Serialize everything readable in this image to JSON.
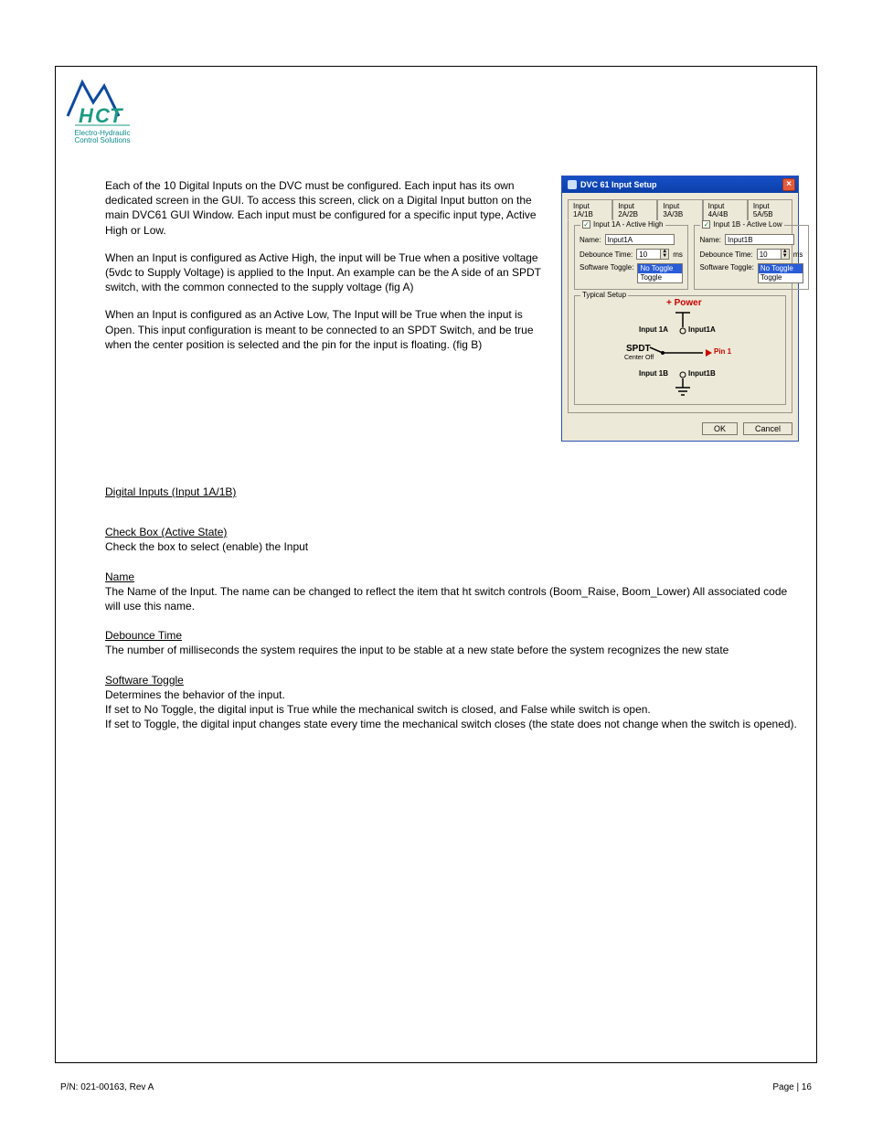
{
  "logo": {
    "brand": "HCT",
    "tag1": "Electro-Hydraulic",
    "tag2": "Control Solutions"
  },
  "intro": {
    "p1": "Each of the 10 Digital Inputs on the DVC must be configured. Each input has its own dedicated screen in the GUI. To access this screen, click on a Digital Input button on the main DVC61 GUI Window. Each input must be configured for a specific input type, Active High or Low.",
    "p2": "When an Input is configured as Active High, the input will be True when a positive voltage (5vdc to Supply Voltage) is applied to the Input. An example can be the A side of an SPDT switch, with the common connected to the supply voltage (fig A)",
    "p3": "When an Input is configured as an Active Low, The Input will be True when the input is Open. This input configuration is meant to be connected to an SPDT Switch, and be true when the center position is selected and the pin for the input is floating. (fig B)"
  },
  "sections": {
    "digital_inputs_heading": "Digital Inputs (Input 1A/1B)",
    "checkbox_heading": "Check Box (Active State)",
    "checkbox_text": "Check the box to select (enable) the Input",
    "name_heading": "Name",
    "name_text": "The Name of the Input. The name can be changed to reflect the item that ht switch controls (Boom_Raise, Boom_Lower) All associated code will use this name.",
    "debounce_heading": "Debounce Time",
    "debounce_text": "The number of milliseconds the system requires the input to be stable at a new state before the system recognizes the new state",
    "toggle_heading": "Software Toggle",
    "toggle_text": "Determines the behavior of the input.",
    "toggle_rule1": "If set to No Toggle, the digital input is True while the mechanical switch is closed, and False while switch is open.",
    "toggle_rule2": "If set to Toggle, the digital input changes state every time the mechanical switch closes (the state does not change when the switch is opened)."
  },
  "dialog": {
    "title": "DVC 61 Input Setup",
    "tabs": [
      "Input 1A/1B",
      "Input 2A/2B",
      "Input 3A/3B",
      "Input 4A/4B",
      "Input 5A/5B"
    ],
    "left": {
      "legend": "Input 1A - Active High",
      "checked": true,
      "name_label": "Name:",
      "name_value": "Input1A",
      "debounce_label": "Debounce Time:",
      "debounce_value": "10",
      "debounce_unit": "ms",
      "toggle_label": "Software Toggle:",
      "toggle_options": [
        "No Toggle",
        "Toggle"
      ],
      "toggle_selected": "No Toggle"
    },
    "right": {
      "legend": "Input 1B - Active Low",
      "checked": true,
      "name_label": "Name:",
      "name_value": "Input1B",
      "debounce_label": "Debounce Time:",
      "debounce_value": "10",
      "debounce_unit": "ms",
      "toggle_label": "Software Toggle:",
      "toggle_options": [
        "No Toggle",
        "Toggle"
      ],
      "toggle_selected": "No Toggle"
    },
    "typical": {
      "legend": "Typical Setup",
      "power": "+ Power",
      "label_1a_pin": "Input 1A",
      "label_1a_name": "Input1A",
      "spdt": "SPDT",
      "spdt_sub": "Center Off",
      "pin1": "Pin 1",
      "label_1b_pin": "Input 1B",
      "label_1b_name": "Input1B"
    },
    "ok": "OK",
    "cancel": "Cancel"
  },
  "footer": {
    "left": "P/N: 021-00163, Rev A",
    "right": "Page | 16"
  }
}
